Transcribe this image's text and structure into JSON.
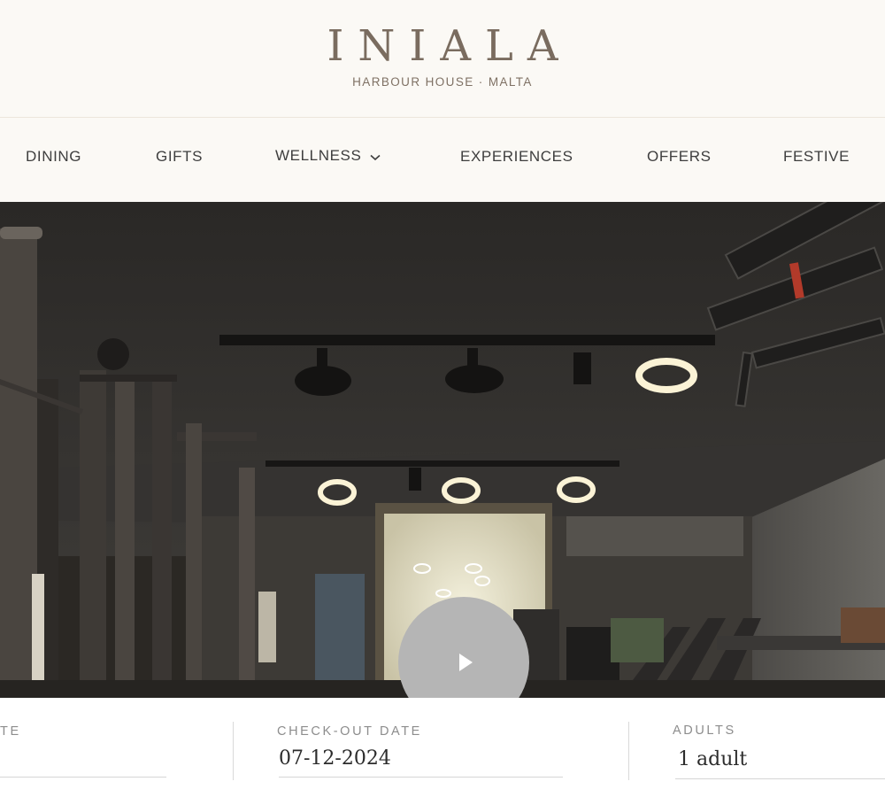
{
  "brand": {
    "logo": "INIALA",
    "tagline": "HARBOUR HOUSE · MALTA"
  },
  "nav": {
    "items": [
      {
        "label": "DINING"
      },
      {
        "label": "GIFTS"
      },
      {
        "label": "WELLNESS",
        "has_dropdown": true
      },
      {
        "label": "EXPERIENCES"
      },
      {
        "label": "OFFERS"
      },
      {
        "label": "FESTIVE"
      }
    ]
  },
  "hero": {
    "media": "gym-video",
    "play_icon": "play-icon"
  },
  "booking": {
    "checkin_label": "TE",
    "checkout_label": "CHECK-OUT DATE",
    "checkout_value": "07-12-2024",
    "adults_label": "ADULTS",
    "adults_value": "1 adult"
  },
  "colors": {
    "background": "#fbf9f5",
    "logo": "#7a6c5f",
    "nav_text": "#3e3e3e",
    "play_button": "#b5b5b5"
  }
}
